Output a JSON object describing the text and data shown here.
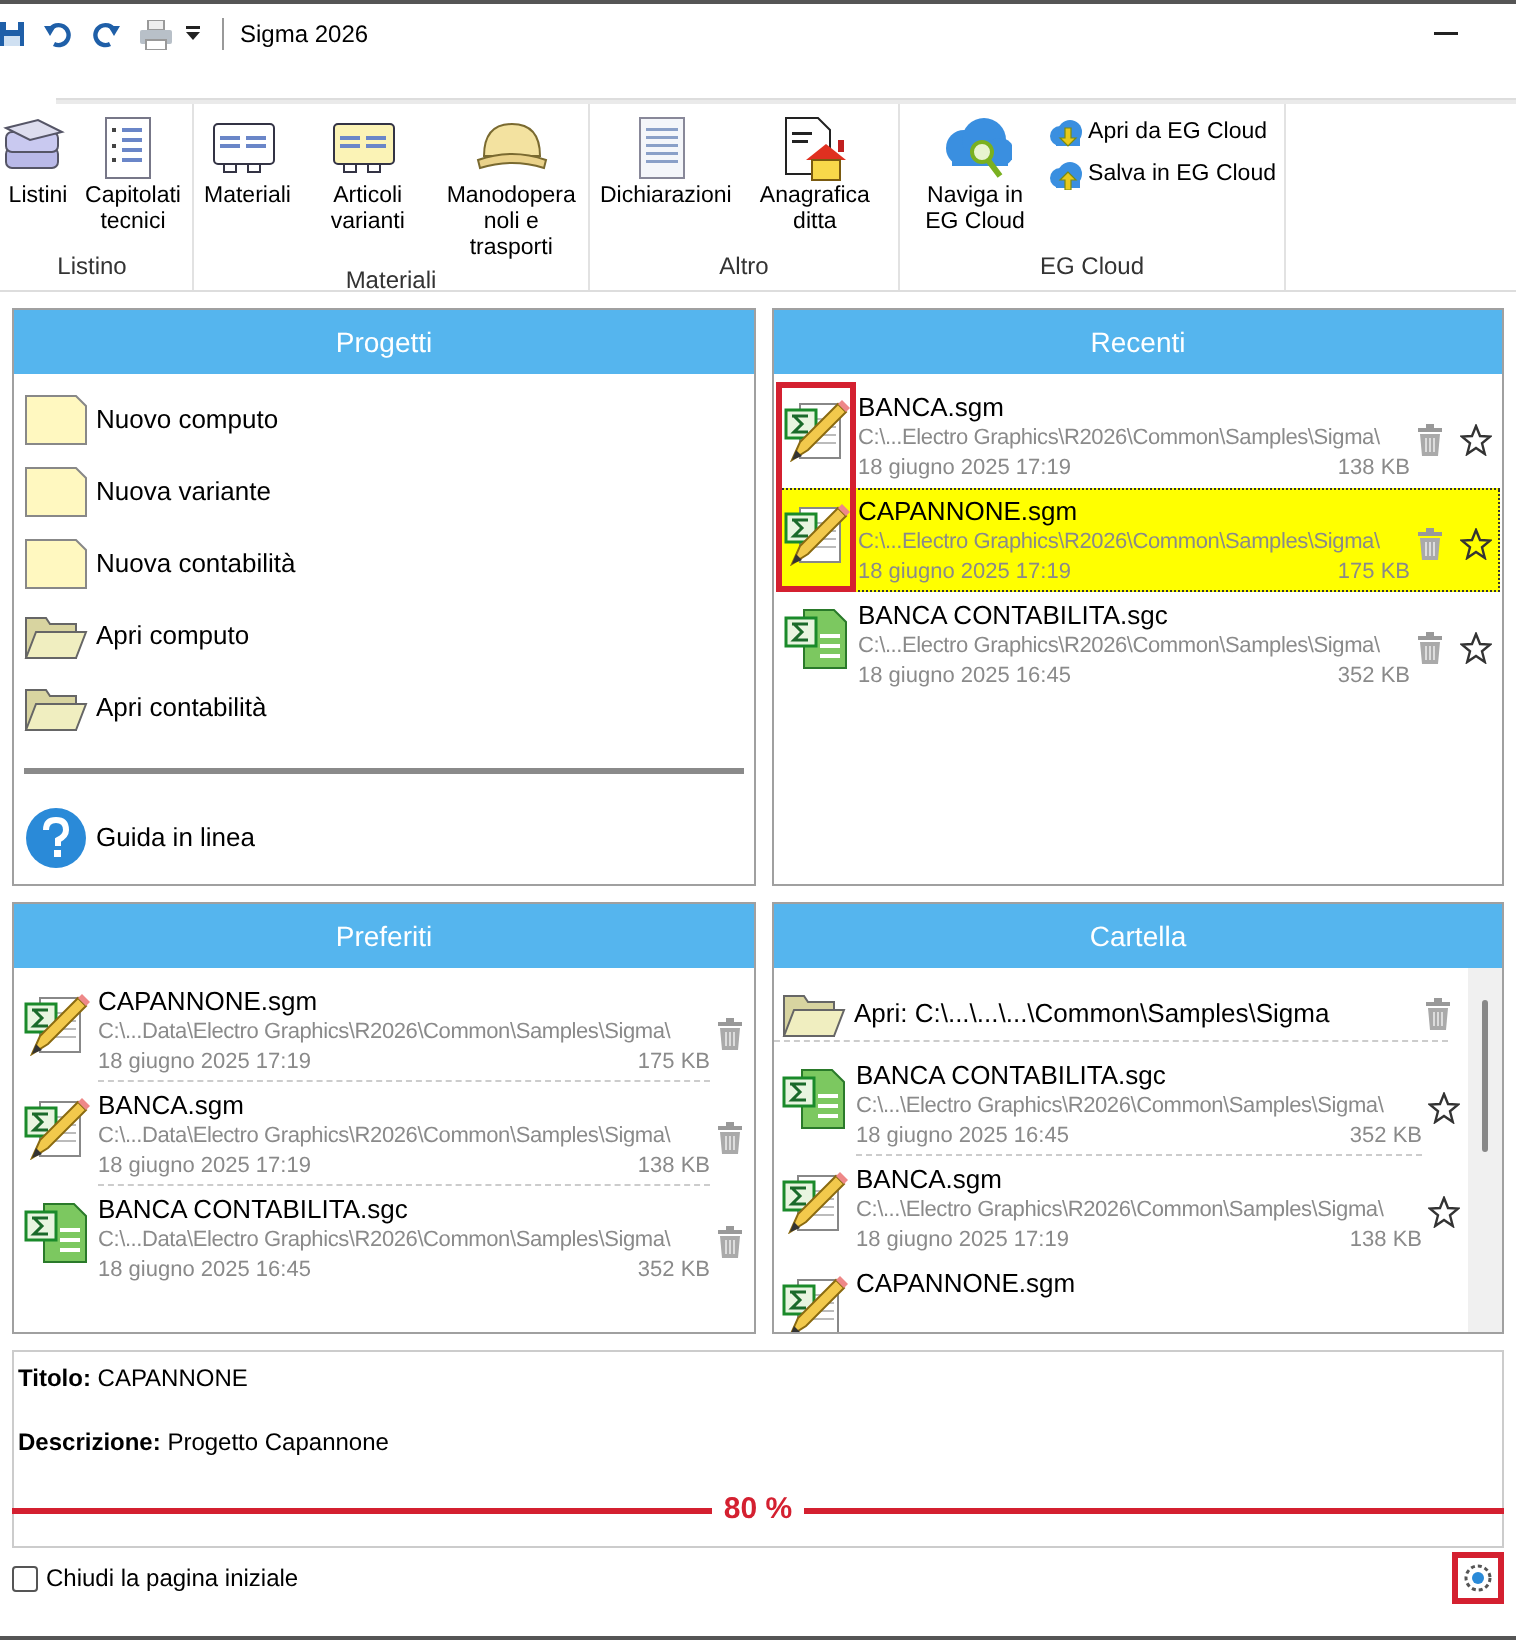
{
  "window": {
    "title": "Sigma 2026"
  },
  "ribbon": {
    "groups": [
      {
        "label": "Listino",
        "items": [
          {
            "label": "Listini",
            "kind": "large"
          },
          {
            "label": "Capitolati tecnici",
            "kind": "large"
          }
        ]
      },
      {
        "label": "Materiali",
        "items": [
          {
            "label": "Materiali",
            "kind": "large"
          },
          {
            "label": "Articoli varianti",
            "kind": "large"
          },
          {
            "label": "Manodopera noli e trasporti",
            "kind": "large"
          }
        ]
      },
      {
        "label": "Altro",
        "items": [
          {
            "label": "Dichiarazioni",
            "kind": "large"
          },
          {
            "label": "Anagrafica ditta",
            "kind": "large"
          }
        ]
      },
      {
        "label": "EG Cloud",
        "items": [
          {
            "label": "Naviga in EG Cloud",
            "kind": "large"
          },
          {
            "label": "Apri da EG Cloud",
            "kind": "small"
          },
          {
            "label": "Salva in EG Cloud",
            "kind": "small"
          }
        ]
      }
    ]
  },
  "progetti": {
    "header": "Progetti",
    "items": [
      {
        "label": "Nuovo computo",
        "kind": "new"
      },
      {
        "label": "Nuova variante",
        "kind": "new"
      },
      {
        "label": "Nuova contabilità",
        "kind": "new"
      },
      {
        "label": "Apri computo",
        "kind": "open"
      },
      {
        "label": "Apri contabilità",
        "kind": "open"
      },
      {
        "label": "Guida in linea",
        "kind": "help"
      }
    ]
  },
  "recenti": {
    "header": "Recenti",
    "icon_highlight": true,
    "files": [
      {
        "name": "BANCA.sgm",
        "path": "C:\\...Electro Graphics\\R2026\\Common\\Samples\\Sigma\\",
        "date": "18 giugno 2025 17:19",
        "size": "138 KB",
        "kind": "sgm",
        "selected": false
      },
      {
        "name": "CAPANNONE.sgm",
        "path": "C:\\...Electro Graphics\\R2026\\Common\\Samples\\Sigma\\",
        "date": "18 giugno 2025 17:19",
        "size": "175 KB",
        "kind": "sgm",
        "selected": true
      },
      {
        "name": "BANCA CONTABILITA.sgc",
        "path": "C:\\...Electro Graphics\\R2026\\Common\\Samples\\Sigma\\",
        "date": "18 giugno 2025 16:45",
        "size": "352 KB",
        "kind": "sgc",
        "selected": false
      }
    ]
  },
  "preferiti": {
    "header": "Preferiti",
    "files": [
      {
        "name": "CAPANNONE.sgm",
        "path": "C:\\...Data\\Electro Graphics\\R2026\\Common\\Samples\\Sigma\\",
        "date": "18 giugno 2025 17:19",
        "size": "175 KB",
        "kind": "sgm"
      },
      {
        "name": "BANCA.sgm",
        "path": "C:\\...Data\\Electro Graphics\\R2026\\Common\\Samples\\Sigma\\",
        "date": "18 giugno 2025 17:19",
        "size": "138 KB",
        "kind": "sgm"
      },
      {
        "name": "BANCA CONTABILITA.sgc",
        "path": "C:\\...Data\\Electro Graphics\\R2026\\Common\\Samples\\Sigma\\",
        "date": "18 giugno 2025 16:45",
        "size": "352 KB",
        "kind": "sgc"
      }
    ]
  },
  "cartella": {
    "header": "Cartella",
    "folder": "Apri: C:\\...\\...\\...\\Common\\Samples\\Sigma",
    "files": [
      {
        "name": "BANCA CONTABILITA.sgc",
        "path": "C:\\...\\Electro Graphics\\R2026\\Common\\Samples\\Sigma\\",
        "date": "18 giugno 2025 16:45",
        "size": "352 KB",
        "kind": "sgc"
      },
      {
        "name": "BANCA.sgm",
        "path": "C:\\...\\Electro Graphics\\R2026\\Common\\Samples\\Sigma\\",
        "date": "18 giugno 2025 17:19",
        "size": "138 KB",
        "kind": "sgm"
      },
      {
        "name": "CAPANNONE.sgm",
        "kind": "sgm"
      }
    ]
  },
  "info": {
    "titolo": "**Titolo:** CAPANNONE",
    "descrizione": "**Descrizione:** Progetto Capannone",
    "zoom": "80 %"
  },
  "footer": {
    "checkbox": {
      "label": "Chiudi la pagina iniziale",
      "checked": false
    },
    "settings_highlight": true
  }
}
